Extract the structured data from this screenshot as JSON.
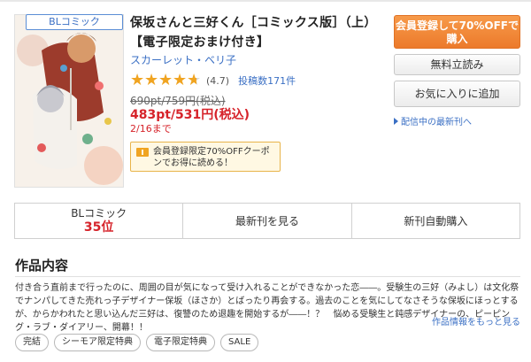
{
  "genre_tag": "BLコミック",
  "book": {
    "title": "保坂さんと三好くん［コミックス版］（上）【電子限定おまけ付き】",
    "author": "スカーレット・ベリ子",
    "rating_value": 4.7,
    "rating_text": "(4.7)",
    "reviews": "投稿数171件",
    "price_old": "690pt/759円(税込)",
    "price_new": "483pt/531円(税込)",
    "deadline": "2/16まで",
    "coupon": "会員登録限定70%OFFクーポンでお得に読める！"
  },
  "actions": {
    "register": "会員登録して70%OFFで購入",
    "free_read": "無料立読み",
    "favorite": "お気に入りに追加",
    "latest": "配信中の最新刊へ"
  },
  "tabs": {
    "genre": "BLコミック",
    "rank": "35位",
    "latest": "最新刊を見る",
    "auto_buy": "新刊自動購入"
  },
  "section": {
    "title": "作品内容",
    "description": "付き合う直前まで行ったのに、周囲の目が気になって受け入れることができなかった恋――。受験生の三好（みよし）は文化祭でナンパしてきた売れっ子デザイナー保坂（ほさか）とばったり再会する。過去のことを気にしてなさそうな保坂にほっとするが、からかわれたと思い込んだ三好は、復讐のため退趣を開始するが――！？　悩める受験生と鈍感デザイナーの、ピーピング・ラブ・ダイアリー、開幕！！",
    "more": "作品情報をもっと見る"
  },
  "tags": [
    "完結",
    "シーモア限定特典",
    "電子限定特典",
    "SALE"
  ],
  "colors": {
    "accent_orange": "#ec7a2b",
    "link_blue": "#3a6fc4",
    "price_red": "#d6232a",
    "star": "#f0a421"
  }
}
